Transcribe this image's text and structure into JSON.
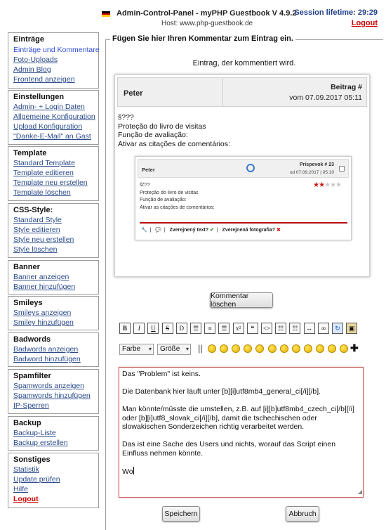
{
  "header": {
    "title": "Admin-Control-Panel - myPHP Guestbook V 4.9.2",
    "host": "Host: www.php-guestbook.de",
    "session": "Session lifetime: 29:29",
    "logout": "Logout"
  },
  "sidebar": {
    "eintraege": {
      "title": "Einträge",
      "items": [
        "Einträge und Kommentare",
        "Foto-Uploads",
        "Admin Blog",
        "Frontend anzeigen"
      ]
    },
    "einstellungen": {
      "title": "Einstellungen",
      "items": [
        "Admin- + Login Daten",
        "Allgemeine Konfiguration",
        "Upload Konfiguration",
        "\"Danke-E-Mail\" an Gast"
      ]
    },
    "template": {
      "title": "Template",
      "items": [
        "Standard Template",
        "Template editieren",
        "Template neu erstellen",
        "Template löschen"
      ]
    },
    "css": {
      "title": "CSS-Style:",
      "items": [
        "Standard Style",
        "Style editieren",
        "Style neu erstellen",
        "Style löschen"
      ]
    },
    "banner": {
      "title": "Banner",
      "items": [
        "Banner anzeigen",
        "Banner hinzufügen"
      ]
    },
    "smileys": {
      "title": "Smileys",
      "items": [
        "Smileys anzeigen",
        "Smiley hinzufügen"
      ]
    },
    "badwords": {
      "title": "Badwords",
      "items": [
        "Badwords anzeigen",
        "Badword hinzufügen"
      ]
    },
    "spamfilter": {
      "title": "Spamfilter",
      "items": [
        "Spamwords anzeigen",
        "Spamwords hinzufügen",
        "IP-Sperren"
      ]
    },
    "backup": {
      "title": "Backup",
      "items": [
        "Backup-Liste",
        "Backup erstellen"
      ]
    },
    "sonstiges": {
      "title": "Sonstiges",
      "items": [
        "Statistik",
        "Update prüfen",
        "Hilfe",
        "Logout"
      ]
    }
  },
  "main": {
    "legend": "Fügen Sie hier Ihren Kommentar zum Eintrag ein.",
    "subtitle": "Eintrag, der kommentiert wird.",
    "entry": {
      "author": "Peter",
      "number": "Beitrag #",
      "date": "vom 07.09.2017 05:11",
      "lines": [
        "š???",
        "Proteção do livro de visitas",
        "Função de avaliação:",
        "Ativar as citações de comentários:"
      ]
    },
    "inner": {
      "author": "Peter",
      "number": "Príspevok # 23",
      "date": "od 07.09.2017 | 05:10",
      "lines": [
        "šč??",
        "Proteção do livro de visitas",
        "Função de avaliação:",
        "Ativar as citações de comentários:"
      ],
      "rating": 2,
      "rating_max": 5,
      "foot_text": "Zverejnený text?",
      "foot_photo": "Zverejnená fotografia?",
      "check_icon": "check-icon",
      "cross_icon": "cross-icon"
    },
    "delete_button": "Kommentar löschen",
    "toolbar": {
      "icons": [
        "bold-icon",
        "italic-icon",
        "underline-icon",
        "strike-icon",
        "dash-icon",
        "align-left-icon",
        "align-center-icon",
        "align-right-icon",
        "superscript-icon",
        "quote-icon",
        "code-icon",
        "list-icon",
        "ordered-list-icon",
        "hr-icon",
        "link-icon",
        "sync-icon",
        "image-icon"
      ],
      "labels": [
        "B",
        "I",
        "U",
        "S",
        "D",
        "",
        "",
        "",
        "x²",
        "",
        "<>",
        "",
        "",
        "",
        "",
        "",
        ""
      ]
    },
    "color_select": "Farbe",
    "size_select": "Größe",
    "textarea_lines": [
      "Das \"Problem\" ist keins.",
      "Die Datenbank hier läuft unter [b][i]utf8mb4_general_ci[/i][/b].",
      "Man könnte/müsste die umstellen, z.B. auf [i][b]utf8mb4_czech_ci[/b][/i] oder [b][i]utf8_slovak_ci[/i][/b], damit die tschechischen oder slowakischen Sonderzeichen richtig verarbeitet werden.",
      "Das ist eine Sache des Users und nichts, worauf das Script einen Einfluss nehmen könnte.",
      "Wo"
    ],
    "save_button": "Speichern",
    "cancel_button": "Abbruch"
  }
}
